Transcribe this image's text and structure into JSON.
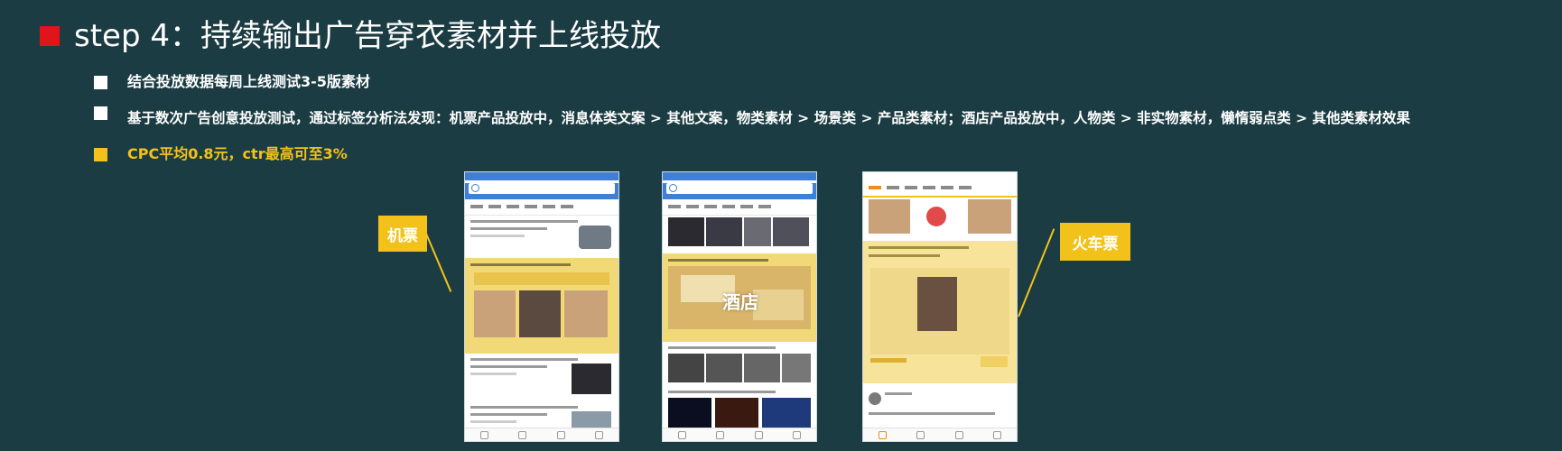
{
  "slide": {
    "title": "step 4：持续输出广告穿衣素材并上线投放",
    "bullets": [
      {
        "text": "结合投放数据每周上线测试3-5版素材",
        "color": "white"
      },
      {
        "text": "基于数次广告创意投放测试，通过标签分析法发现：机票产品投放中，消息体类文案 > 其他文案，物类素材 > 场景类 > 产品类素材；酒店产品投放中，人物类 > 非实物素材，懒惰弱点类 > 其他类素材效果",
        "color": "white"
      },
      {
        "text": "CPC平均0.8元，ctr最高可至3%",
        "color": "yellow"
      }
    ]
  },
  "screens": {
    "left_tag": "机票",
    "middle_overlay": "酒店",
    "right_tag": "火车票"
  },
  "colors": {
    "background": "#1b3c43",
    "title_bullet": "#e0141a",
    "accent_yellow": "#f3c21a"
  }
}
